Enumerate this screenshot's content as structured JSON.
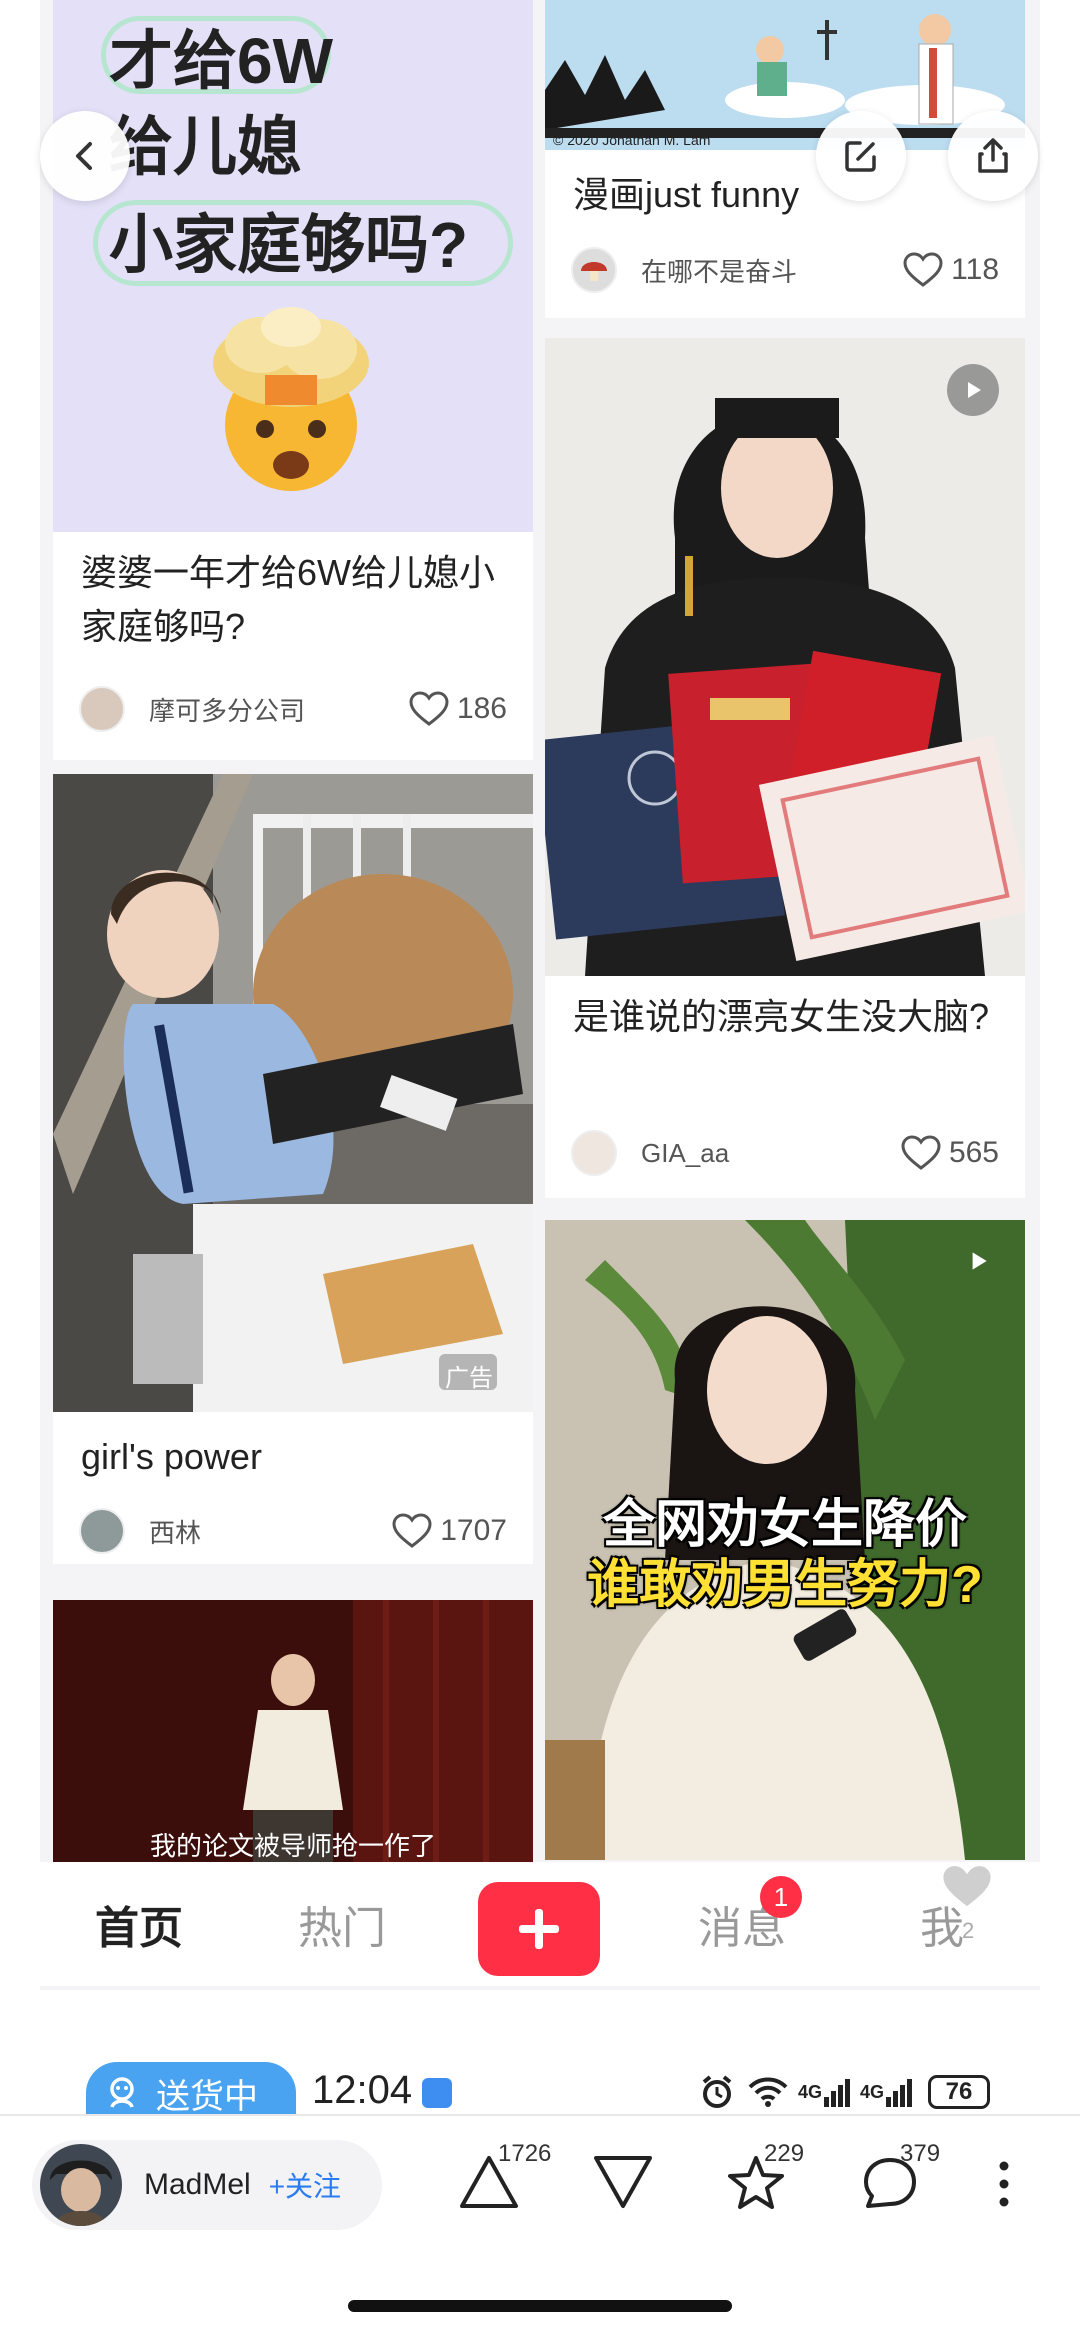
{
  "feed": {
    "left_column": [
      {
        "id": "post-1",
        "cover_lines": [
          "才给6W",
          "给儿媳",
          "小家庭够吗?"
        ],
        "title": "婆婆一年才给6W给儿媳小家庭够吗?",
        "author": "摩可多分公司",
        "likes": "186"
      },
      {
        "id": "post-2",
        "ad_label": "广告",
        "title": "girl's power",
        "author": "西林",
        "likes": "1707"
      },
      {
        "id": "post-3",
        "caption": "我的论文被导师抢一作了"
      }
    ],
    "right_column": [
      {
        "id": "post-4",
        "comic_credit": "© 2020 Jonathan M. Lam",
        "title": "漫画just funny",
        "author": "在哪不是奋斗",
        "likes": "118"
      },
      {
        "id": "post-5",
        "title": "是谁说的漂亮女生没大脑?",
        "author": "GIA_aa",
        "likes": "565"
      },
      {
        "id": "post-6",
        "overlay_line1": "全网劝女生降价",
        "overlay_line2": "谁敢劝男生努力?"
      }
    ]
  },
  "tabbar": {
    "home": "首页",
    "hot": "热门",
    "messages": "消息",
    "messages_badge": "1",
    "me": "我",
    "floating_like_count": "2"
  },
  "status": {
    "delivery_label": "送货中",
    "time": "12:04",
    "network": "4G",
    "battery": "76"
  },
  "actionbar": {
    "username": "MadMel",
    "follow_label": "+关注",
    "upvotes": "1726",
    "favorites": "229",
    "comments": "379"
  },
  "colors": {
    "accent_red": "#ff2f46",
    "follow_blue": "#2b7cf0",
    "delivery_blue": "#4aa3f0",
    "cover_lavender": "#e3e0f7"
  }
}
